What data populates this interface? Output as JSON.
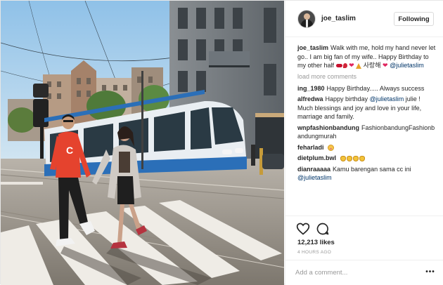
{
  "post": {
    "username": "joe_taslim",
    "follow_label": "Following",
    "caption_user": "joe_taslim",
    "caption_text": "Walk with me, hold my hand never let go.. I am big fan of my wife.. Happy Birthday to my other half",
    "caption_korean": "사랑해",
    "caption_mention": "@julietaslim",
    "load_more": "load more comments",
    "likes": "12,213 likes",
    "time": "4 HOURS AGO",
    "comment_placeholder": "Add a comment...",
    "more_label": "•••"
  },
  "comments": [
    {
      "user": "ing_1980",
      "text": "Happy Birthday..... Always success",
      "mention": ""
    },
    {
      "user": "alfredwa",
      "text": "Happy birthday",
      "mention": "@julietaslim",
      "text2": "julie ! Much blessings and joy and love in your life, marriage and family."
    },
    {
      "user": "wnpfashionbandung",
      "text": "FashionbandungFashionbandungmurah",
      "mention": ""
    },
    {
      "user": "feharladi",
      "text": "",
      "mention": ""
    },
    {
      "user": "dietplum.bwl",
      "text": "",
      "mention": ""
    },
    {
      "user": "dianraaaaa",
      "text": "Kamu barengan sama cc ini",
      "mention": "@julietaslim"
    }
  ],
  "icons": {
    "like": "heart-icon",
    "comment": "comment-icon",
    "more": "more-options-icon"
  },
  "colors": {
    "mention": "#003569",
    "tram_blue": "#2b6fb8",
    "shirt_red": "#e5432e",
    "sky": "#9cc7e6"
  }
}
